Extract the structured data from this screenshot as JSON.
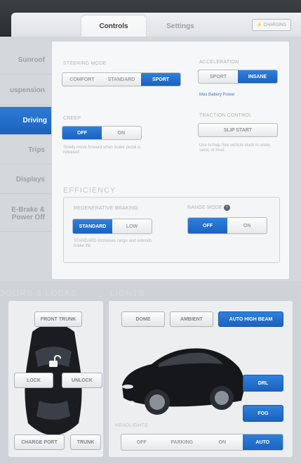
{
  "tabs": {
    "controls": "Controls",
    "settings": "Settings",
    "charging": "CHARGING"
  },
  "sidebar": {
    "items": [
      {
        "label": "Sunroof"
      },
      {
        "label": "uspension"
      },
      {
        "label": "Driving"
      },
      {
        "label": "Trips"
      },
      {
        "label": "Displays"
      },
      {
        "label": "E-Brake & Power Off"
      }
    ]
  },
  "driving": {
    "steering": {
      "label": "STEERING MODE",
      "options": [
        "COMFORT",
        "STANDARD",
        "SPORT"
      ],
      "selected": "SPORT"
    },
    "acceleration": {
      "label": "ACCELERATION",
      "options": [
        "SPORT",
        "INSANE"
      ],
      "selected": "INSANE",
      "link": "Max Battery Power"
    },
    "creep": {
      "label": "CREEP",
      "options": [
        "OFF",
        "ON"
      ],
      "selected": "OFF",
      "hint": "Slowly move forward when brake pedal is released"
    },
    "traction": {
      "label": "TRACTION CONTROL",
      "button": "SLIP START",
      "hint": "Use to help free vehicle stuck in snow, sand, or mud."
    },
    "efficiency": {
      "title": "EFFICIENCY",
      "regen": {
        "label": "REGENERATIVE BRAKING",
        "options": [
          "STANDARD",
          "LOW"
        ],
        "selected": "STANDARD",
        "hint": "STANDARD increases range and extends brake life"
      },
      "range": {
        "label": "RANGE MODE",
        "options": [
          "OFF",
          "ON"
        ],
        "selected": "OFF"
      }
    }
  },
  "doors": {
    "title": "DOORS & LOCKS",
    "front_trunk": "FRONT TRUNK",
    "lock": "LOCK",
    "unlock": "UNLOCK",
    "charge_port": "CHARGE PORT",
    "trunk": "TRUNK"
  },
  "lights": {
    "title": "LIGHTS",
    "dome": "DOME",
    "ambient": "AMBIENT",
    "auto_high_beam": "AUTO HIGH BEAM",
    "drl": "DRL",
    "fog": "FOG",
    "headlights": {
      "label": "HEADLIGHTS",
      "options": [
        "OFF",
        "PARKING",
        "ON",
        "AUTO"
      ],
      "selected": "AUTO"
    }
  },
  "colors": {
    "accent": "#1f68c6",
    "panel": "#f6f7f8",
    "muted": "#9ca1a8"
  }
}
